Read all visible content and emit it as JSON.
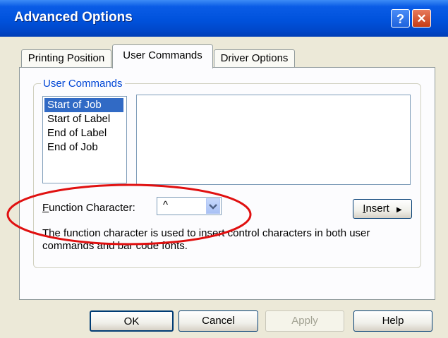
{
  "window": {
    "title": "Advanced Options",
    "help_label": "?",
    "close_label": "✕"
  },
  "tabs": [
    {
      "label": "Printing Position",
      "active": false
    },
    {
      "label": "User Commands",
      "active": true
    },
    {
      "label": "Driver Options",
      "active": false
    }
  ],
  "group": {
    "legend": "User Commands",
    "list_items": [
      "Start of Job",
      "Start of Label",
      "End of Label",
      "End of Job"
    ],
    "selected_item": "Start of Job",
    "command_text": "",
    "function_character": {
      "label_prefix": "F",
      "label_rest": "unction Character:",
      "value": "^"
    },
    "insert_button": {
      "label_prefix": "I",
      "label_rest": "nsert"
    },
    "description": [
      "The function character is used to insert control characters in both user",
      "commands and bar code fonts."
    ]
  },
  "buttons": {
    "ok": "OK",
    "cancel": "Cancel",
    "apply": "Apply",
    "help": "Help"
  },
  "annotation": {
    "ellipse_color": "#e01010"
  }
}
